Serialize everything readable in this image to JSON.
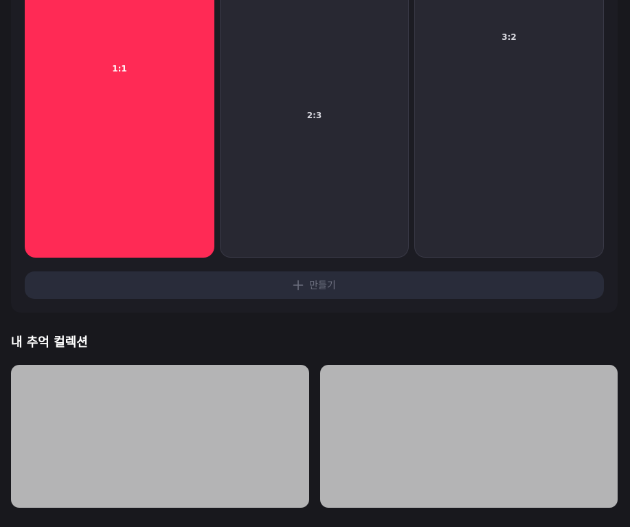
{
  "ratios": [
    {
      "label": "1:1",
      "selected": true
    },
    {
      "label": "2:3",
      "selected": false
    },
    {
      "label": "3:2",
      "selected": false
    }
  ],
  "create_button": {
    "label": "만들기",
    "icon": "plus-icon"
  },
  "collection": {
    "title": "내 추억 컬렉션"
  },
  "colors": {
    "accent": "#ff2a55",
    "background": "#18181d",
    "panel": "#1c1c23",
    "card": "#282832",
    "button": "#292c3a",
    "placeholder": "#b4b4b5"
  }
}
